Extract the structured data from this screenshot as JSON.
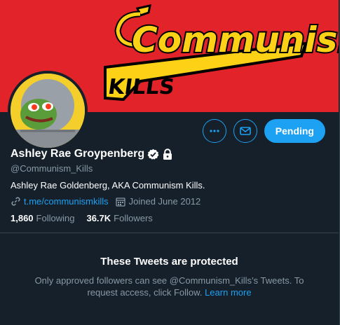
{
  "banner": {
    "word_top": "Communism",
    "word_bottom": "KILLS",
    "colors": {
      "background": "#e2232a",
      "fill": "#fcd116",
      "outline": "#000000"
    }
  },
  "profile": {
    "avatar_icon": "pepe-frog-avatar",
    "display_name": "Ashley Rae Groypenberg",
    "verified_icon": "verified-badge-icon",
    "lock_icon": "lock-icon",
    "handle": "@Communism_Kills",
    "bio": "Ashley Rae Goldenberg, AKA Communism Kills.",
    "link": "t.me/communismkills",
    "joined": "Joined June 2012",
    "following_count": "1,860",
    "following_label": "Following",
    "followers_count": "36.7K",
    "followers_label": "Followers"
  },
  "actions": {
    "more_icon": "more-icon",
    "message_icon": "envelope-icon",
    "pending_label": "Pending"
  },
  "protected": {
    "title": "These Tweets are protected",
    "description": "Only approved followers can see @Communism_Kills’s Tweets. To request access, click Follow.",
    "learn_more": "Learn more"
  },
  "colors": {
    "accent": "#1da1f2",
    "background": "#15202b",
    "secondary_text": "#8899a6",
    "border": "#38444d"
  }
}
